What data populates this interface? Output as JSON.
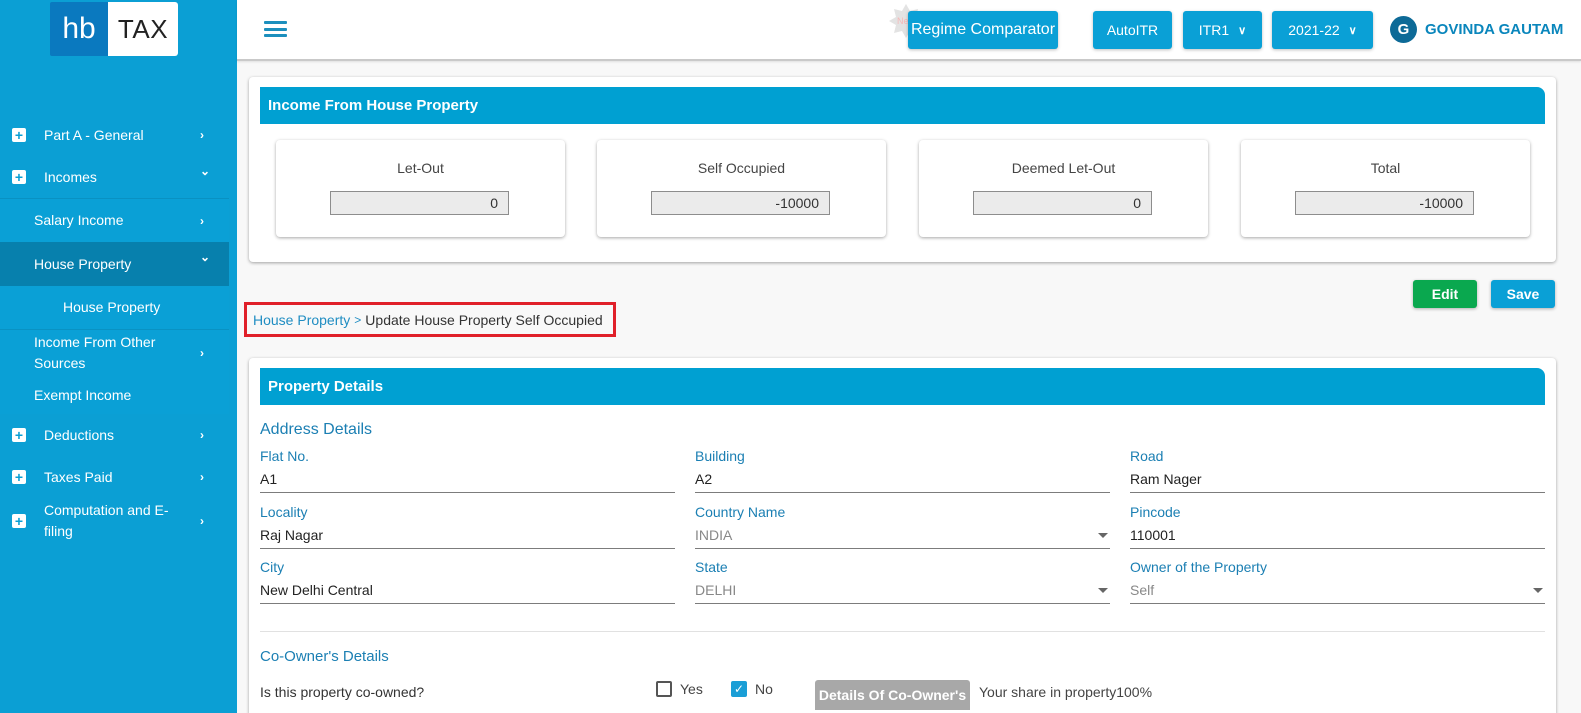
{
  "logo": {
    "left": "hb",
    "right": "TAX"
  },
  "sidebar": {
    "items": [
      {
        "label": "Part A - General",
        "icon": "plus-icon",
        "chevron": "›"
      },
      {
        "label": "Incomes",
        "icon": "plus-icon",
        "chevron": "⌄"
      },
      {
        "label": "Salary Income",
        "chevron": "›"
      },
      {
        "label": "House Property",
        "chevron": "⌄"
      },
      {
        "label": "House Property"
      },
      {
        "label": "Income From Other Sources",
        "chevron": "›"
      },
      {
        "label": "Exempt Income"
      },
      {
        "label": "Deductions",
        "icon": "plus-icon",
        "chevron": "›"
      },
      {
        "label": "Taxes Paid",
        "icon": "plus-icon",
        "chevron": "›"
      },
      {
        "label": "Computation and E-filing",
        "icon": "plus-icon",
        "chevron": "›"
      }
    ]
  },
  "header": {
    "menu_icon": "hamburger-icon",
    "new_badge": "New",
    "regime_comparator": "Regime Comparator",
    "auto_itr": "AutoITR",
    "itr_select": "ITR1",
    "year_select": "2021-22",
    "user_initial": "G",
    "user_name": "GOVINDA GAUTAM",
    "caret": "⌄"
  },
  "summary": {
    "title": "Income From House Property",
    "cards": [
      {
        "label": "Let-Out",
        "value": "0"
      },
      {
        "label": "Self Occupied",
        "value": "-10000"
      },
      {
        "label": "Deemed Let-Out",
        "value": "0"
      },
      {
        "label": "Total",
        "value": "-10000"
      }
    ]
  },
  "actions": {
    "edit": "Edit",
    "save": "Save",
    "edit_color": "#0aa84f",
    "save_color": "#0aa0d6"
  },
  "breadcrumb": {
    "link": "House Property",
    "separator": ">",
    "current": "Update House Property Self Occupied"
  },
  "details": {
    "title": "Property Details",
    "address_title": "Address Details",
    "fields": {
      "flat": {
        "label": "Flat No.",
        "value": "A1"
      },
      "building": {
        "label": "Building",
        "value": "A2"
      },
      "road": {
        "label": "Road",
        "value": "Ram Nager"
      },
      "locality": {
        "label": "Locality",
        "value": "Raj Nagar"
      },
      "country": {
        "label": "Country Name",
        "value": "INDIA"
      },
      "pincode": {
        "label": "Pincode",
        "value": "110001"
      },
      "city": {
        "label": "City",
        "value": "New Delhi Central"
      },
      "state": {
        "label": "State",
        "value": "DELHI"
      },
      "owner": {
        "label": "Owner of the Property",
        "value": "Self"
      }
    },
    "coowner": {
      "title": "Co-Owner's Details",
      "question": "Is this property co-owned?",
      "yes": "Yes",
      "no": "No",
      "yes_checked": false,
      "no_checked": true,
      "check_mark": "✓",
      "details_button": "Details Of Co-Owner's",
      "share_text": "Your share in property100%"
    }
  }
}
